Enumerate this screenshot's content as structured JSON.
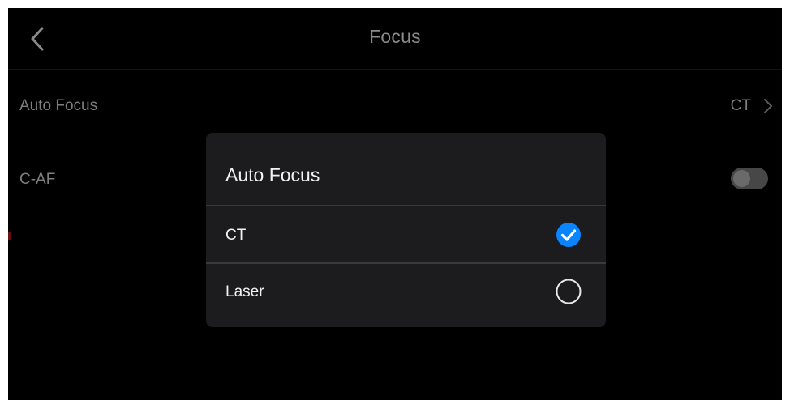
{
  "header": {
    "title": "Focus",
    "back_icon": "chevron-left-icon"
  },
  "settings": {
    "auto_focus": {
      "label": "Auto Focus",
      "value": "CT",
      "icon": "chevron-right-icon"
    },
    "caf": {
      "label": "C-AF",
      "enabled": false
    }
  },
  "dialog": {
    "title": "Auto Focus",
    "options": [
      {
        "label": "CT",
        "selected": true
      },
      {
        "label": "Laser",
        "selected": false
      }
    ]
  },
  "colors": {
    "background": "#000000",
    "dialog_background": "#1c1c1e",
    "accent": "#0a84ff",
    "text_primary": "#f2f2f2",
    "text_dim": "#7e7e7e"
  }
}
